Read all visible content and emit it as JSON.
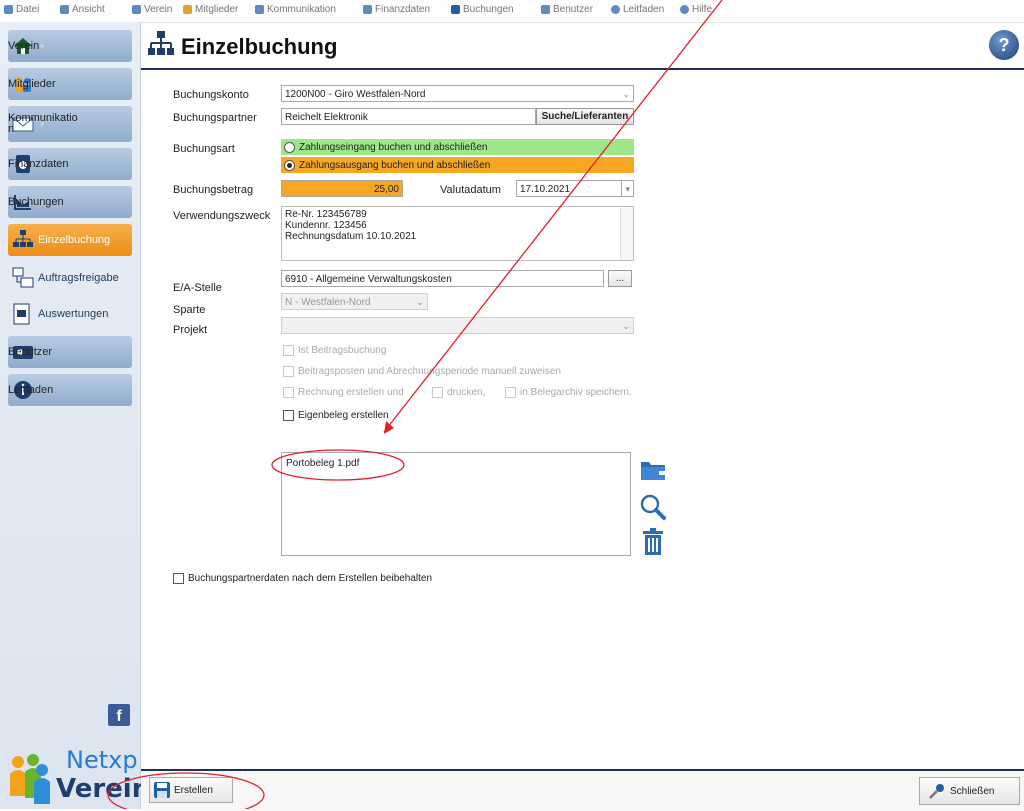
{
  "menu": [
    {
      "label": "Datei",
      "color": "#5c8ac1"
    },
    {
      "label": "Ansicht",
      "color": "#5c8ac1"
    },
    {
      "label": "Verein",
      "color": "#5c8ac1"
    },
    {
      "label": "Mitglieder",
      "color": "#5c8ac1"
    },
    {
      "label": "Kommunikation",
      "color": "#5c8ac1"
    },
    {
      "label": "Finanzdaten",
      "color": "#5c8ac1"
    },
    {
      "label": "Buchungen",
      "color": "#1f5fa6"
    },
    {
      "label": "Benutzer",
      "color": "#5c8ac1"
    },
    {
      "label": "Leitfaden",
      "color": "#5c8ac1"
    },
    {
      "label": "Hilfe",
      "color": "#5c8ac1"
    }
  ],
  "sidebar": {
    "verein": "Verein",
    "mitglieder": "Mitglieder",
    "kommunikation": "Kommunikatio\nn",
    "finanzdaten": "Finanzdaten",
    "buchungen": "Buchungen",
    "einzelbuchung": "Einzelbuchung",
    "auftragsfreigabe": "Auftragsfreigabe",
    "auswertungen": "Auswertungen",
    "benutzer": "Benutzer",
    "leitfaden": "Leitfaden",
    "logo_top": "Netxp",
    "logo_bottom": "Verein"
  },
  "header": {
    "title": "Einzelbuchung"
  },
  "form": {
    "buchungskonto_label": "Buchungskonto",
    "buchungskonto_value": "1200N00 - Giro Westfalen-Nord",
    "buchungspartner_label": "Buchungspartner",
    "buchungspartner_value": "Reichelt Elektronik",
    "suche_button": "Suche/Lieferanten",
    "buchungsart_label": "Buchungsart",
    "buchungsart_in": "Zahlungseingang buchen und abschließen",
    "buchungsart_out": "Zahlungsausgang buchen und abschließen",
    "buchungsbetrag_label": "Buchungsbetrag",
    "buchungsbetrag_value": "25,00",
    "valutadatum_label": "Valutadatum",
    "valutadatum_value": "17.10.2021",
    "verwendungszweck_label": "Verwendungszweck",
    "verwendungszweck_lines": [
      "Re-Nr. 123456789",
      "Kundennr. 123456",
      "Rechnungsdatum 10.10.2021"
    ],
    "ea_label": "E/A-Stelle",
    "ea_value": "6910 - Allgemeine Verwaltungskosten",
    "ea_button": "...",
    "sparte_label": "Sparte",
    "sparte_value": "N - Westfalen-Nord",
    "projekt_label": "Projekt",
    "projekt_value": "",
    "cb_beitrag": "Ist Beitragsbuchung",
    "cb_periode": "Beitragsposten und Abrechnungsperiode manuell zuweisen",
    "cb_rechnung": "Rechnung erstellen und",
    "cb_drucken": "drucken,",
    "cb_archiv": "in Belegarchiv speichern.",
    "cb_eigenbeleg": "Eigenbeleg erstellen",
    "attachment": "Portobeleg 1.pdf",
    "cb_partnerdaten": "Buchungspartnerdaten nach dem Erstellen beibehalten"
  },
  "footer": {
    "erstellen": "Erstellen",
    "schliessen": "Schließen"
  },
  "colors": {
    "in_green": "#9ee68a",
    "out_orange": "#f5a623",
    "annotation_red": "#e3202a"
  }
}
